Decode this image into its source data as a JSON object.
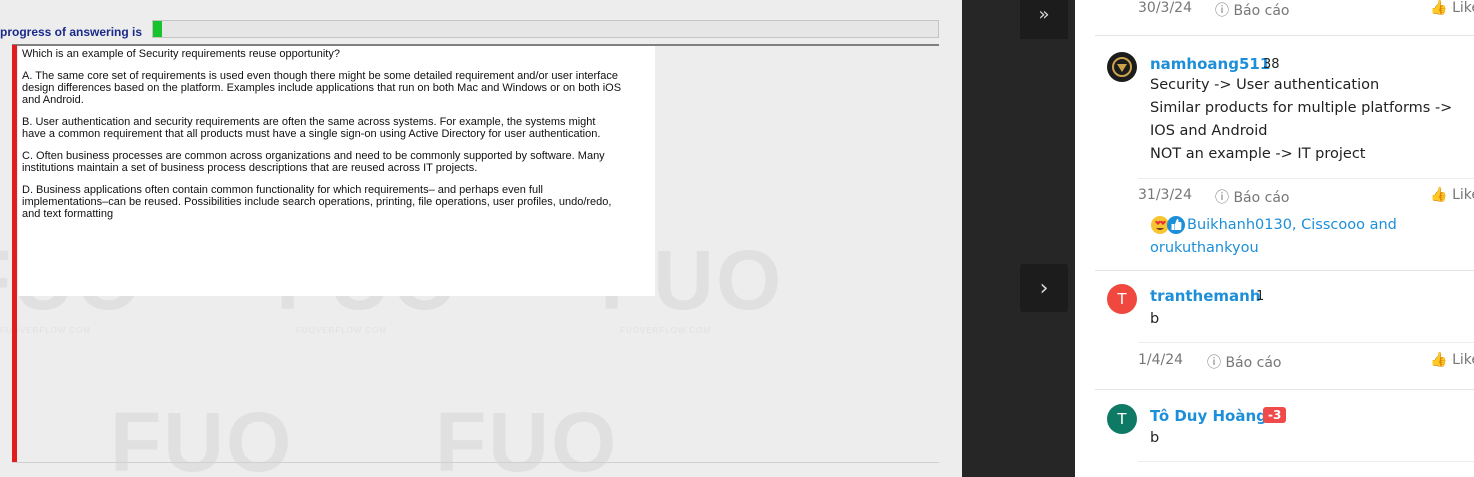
{
  "exam": {
    "progress_label": "progress of answering is",
    "progress_value": 0.012,
    "question": "Which is an example of Security requirements reuse opportunity?",
    "options": [
      "A.  The same core set of requirements is used even though there might be some detailed requirement and/or user interface design differences based on the platform. Examples include applications that run on both Mac and Windows or on both iOS and Android.",
      "B.  User authentication and security requirements are often the same across systems. For example, the systems might have a common requirement that all products must have a single sign-on using Active Directory for user authentication.",
      "C.  Often business processes are common across organizations and need to be commonly supported by software. Many institutions maintain a set of business process descriptions that are reused across IT projects.",
      "D.  Business applications often contain common functionality for which requirements– and perhaps even full implementations–can be reused. Possibilities include search operations, printing, file operations, user profiles, undo/redo, and text formatting"
    ],
    "watermark": {
      "logo": "FUO",
      "site": "FUOVERFLOW.COM"
    }
  },
  "nav": {
    "expand_icon": "double-chevron-right-icon",
    "expand_glyph": "»",
    "next_icon": "chevron-right-icon",
    "next_glyph": "›"
  },
  "comments": {
    "top_meta": {
      "date": "30/3/24",
      "report": "ⓘ Báo cáo",
      "like": "Like"
    },
    "items": [
      {
        "username": "namhoang511",
        "points": "38",
        "avatar_letter": "",
        "avatar_color": "#1c1c1c",
        "lines": [
          "Security -> User authentication",
          "Similar products for multiple platforms ->",
          "IOS and Android",
          "NOT an example -> IT project"
        ],
        "date": "31/3/24",
        "report": "ⓘ Báo cáo",
        "like": "Like",
        "reactions": {
          "icons": [
            "heart-eyes-emoji-icon",
            "thumbs-up-reaction-icon"
          ],
          "names": "Buikhanh0130, Cisscooo and orukuthankyou"
        }
      },
      {
        "username": "tranthemanh",
        "points": "1",
        "avatar_letter": "T",
        "avatar_color": "#f0483e",
        "lines": [
          "b"
        ],
        "date": "1/4/24",
        "report": "ⓘ Báo cáo",
        "like": "Like"
      },
      {
        "username": "Tô Duy Hoàng",
        "points": "-3",
        "avatar_letter": "T",
        "avatar_color": "#0e7a66",
        "lines": [
          "b"
        ],
        "date": "",
        "report": "",
        "like": ""
      }
    ]
  },
  "colors": {
    "link": "#1d8fd8",
    "progress": "#18c22c",
    "accent_bar": "#e11d1d",
    "negative": "#ef4b4b"
  }
}
